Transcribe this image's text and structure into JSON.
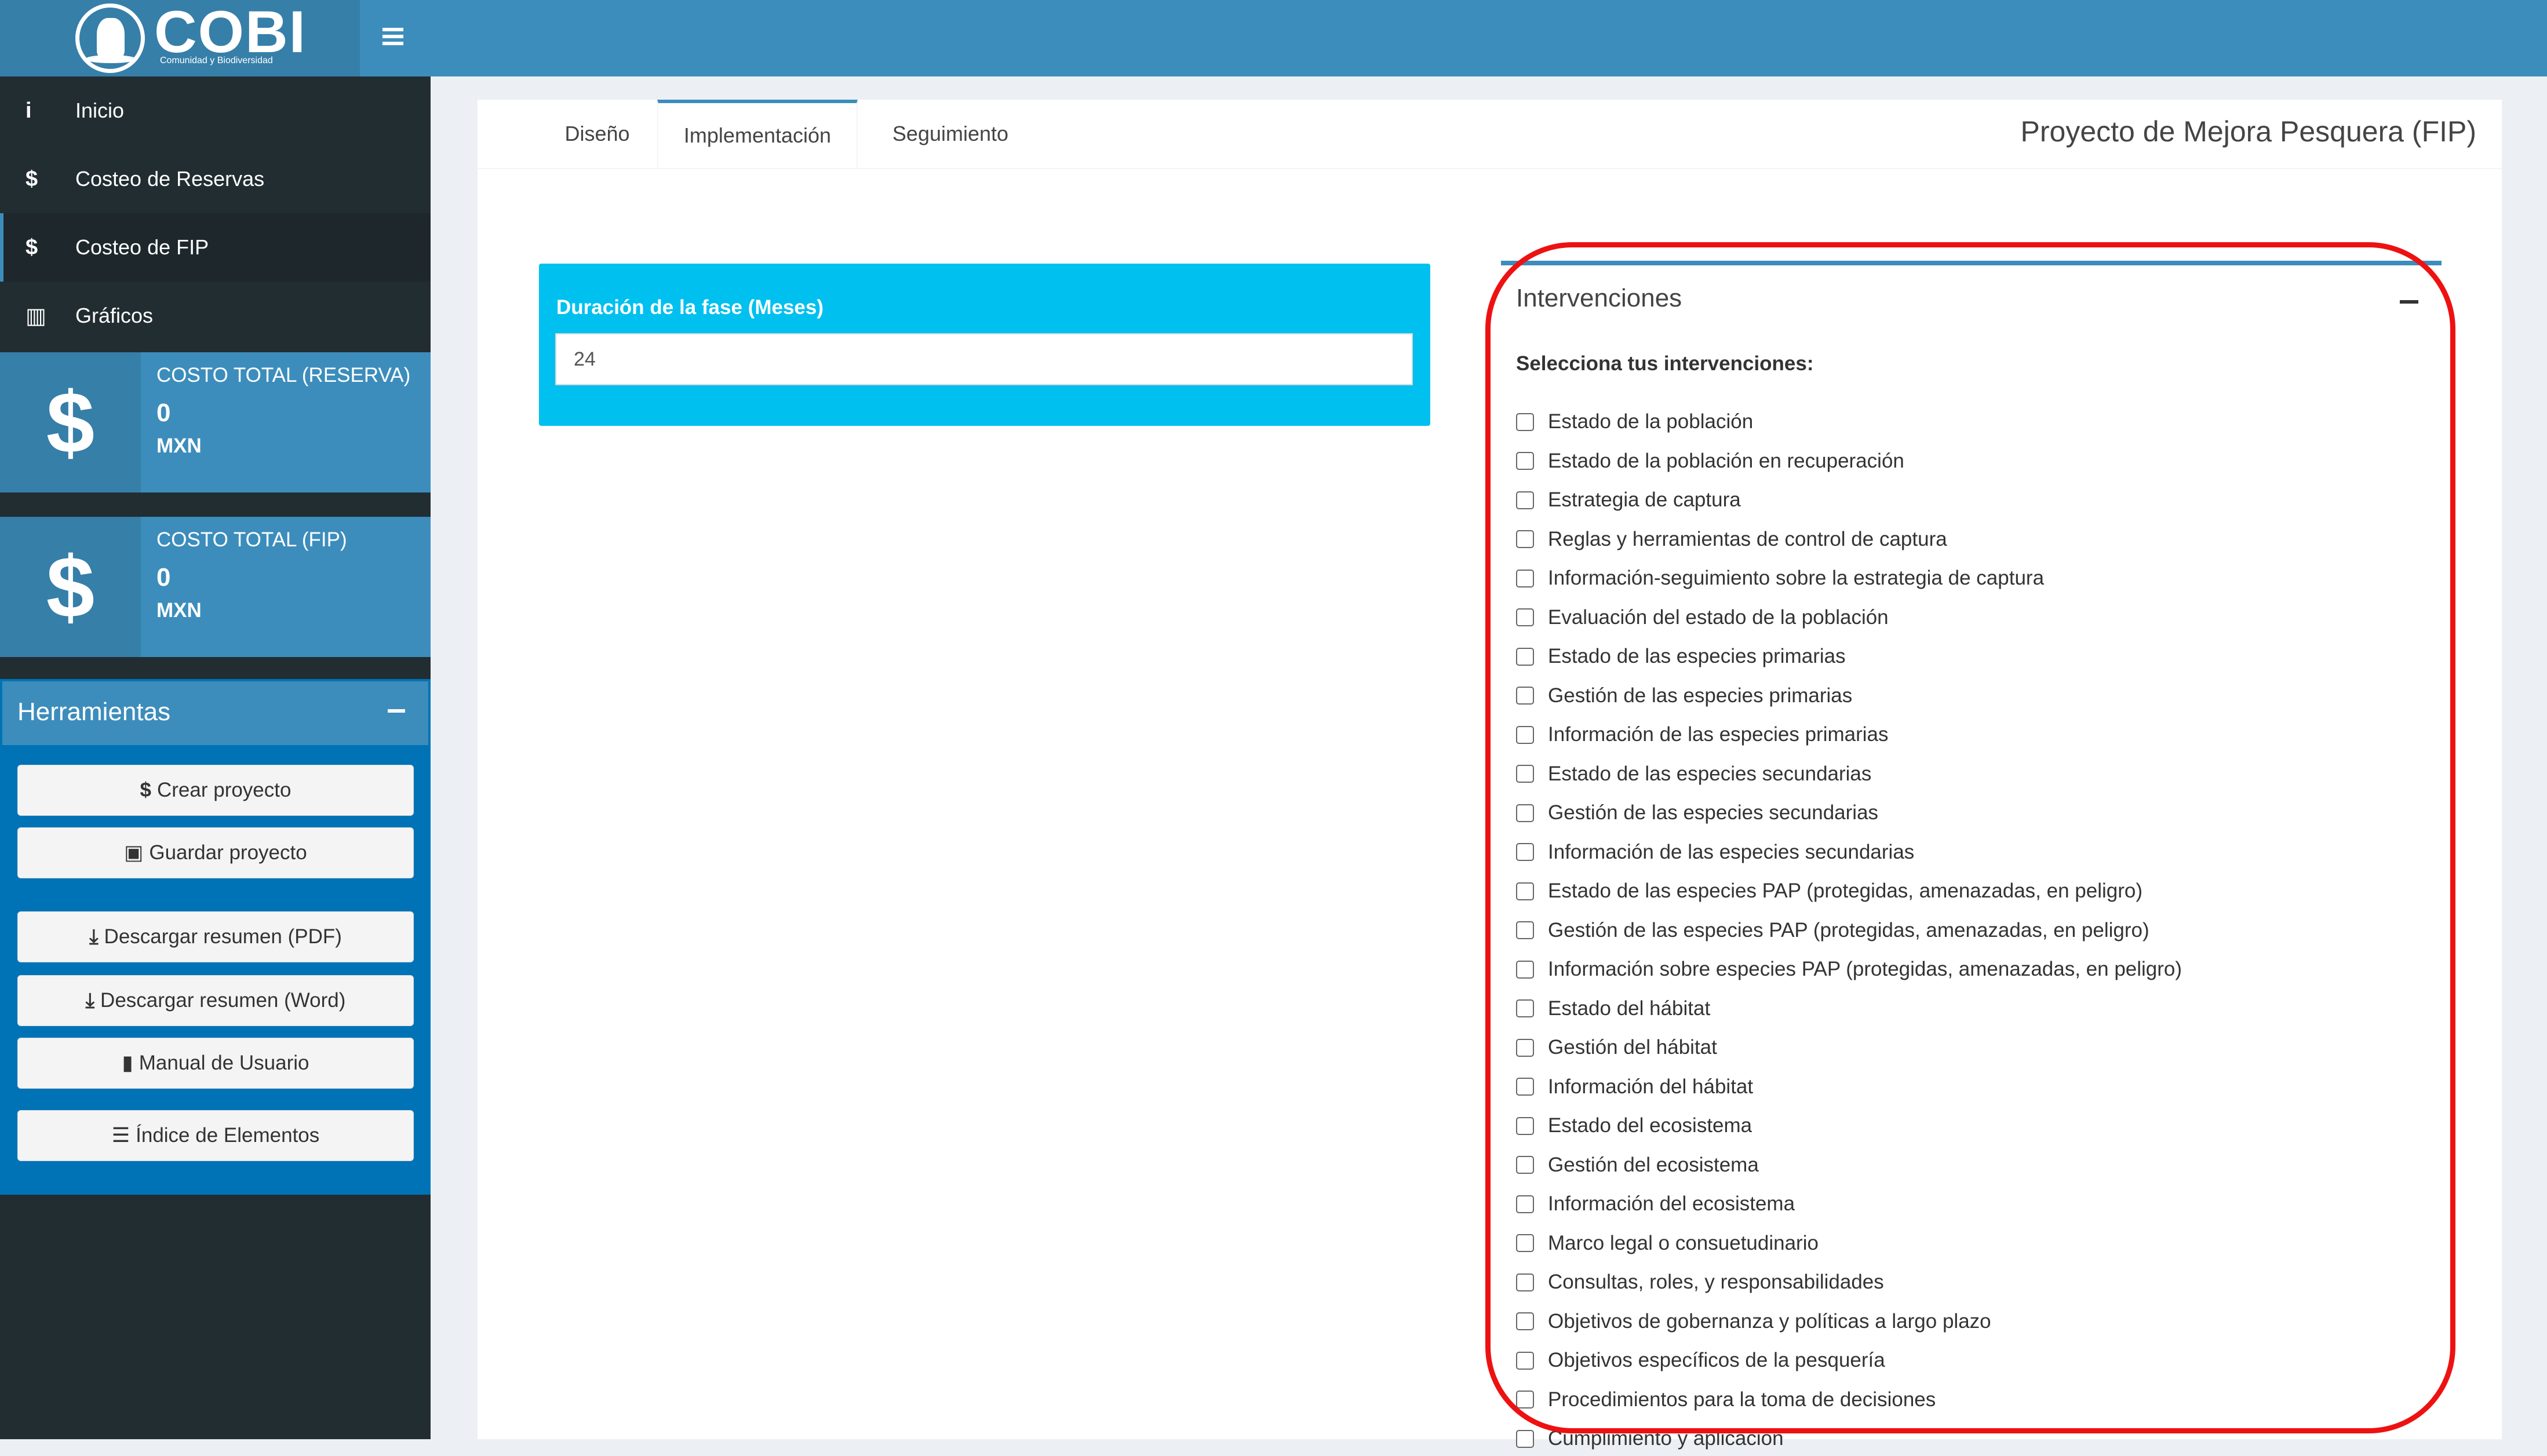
{
  "header": {
    "logo_text": "COBI",
    "logo_subtitle": "Comunidad y Biodiversidad"
  },
  "sidebar": {
    "items": [
      {
        "icon": "info-icon",
        "glyph": "i",
        "label": "Inicio"
      },
      {
        "icon": "dollar-icon",
        "glyph": "$",
        "label": "Costeo de Reservas"
      },
      {
        "icon": "dollar-icon",
        "glyph": "$",
        "label": "Costeo de FIP",
        "active": true
      },
      {
        "icon": "bar-chart-icon",
        "glyph": "▥",
        "label": "Gráficos"
      }
    ],
    "value_boxes": [
      {
        "title": "COSTO TOTAL (RESERVA)",
        "value": "0",
        "unit": "MXN",
        "icon": "dollar-icon"
      },
      {
        "title": "COSTO TOTAL (FIP)",
        "value": "0",
        "unit": "MXN",
        "icon": "dollar-icon"
      }
    ],
    "tools": {
      "title": "Herramientas",
      "buttons": [
        {
          "icon": "dollar-icon",
          "glyph": "$",
          "label": "Crear proyecto"
        },
        {
          "icon": "save-icon",
          "glyph": "▣",
          "label": "Guardar proyecto"
        },
        {
          "icon": "download-icon",
          "glyph": "⤓",
          "label": "Descargar resumen (PDF)"
        },
        {
          "icon": "download-icon",
          "glyph": "⤓",
          "label": "Descargar resumen (Word)"
        },
        {
          "icon": "book-icon",
          "glyph": "▮",
          "label": "Manual de Usuario"
        },
        {
          "icon": "list-icon",
          "glyph": "☰",
          "label": "Índice de Elementos"
        }
      ]
    }
  },
  "main": {
    "tabs": [
      {
        "label": "Diseño"
      },
      {
        "label": "Implementación",
        "active": true
      },
      {
        "label": "Seguimiento"
      }
    ],
    "page_title": "Proyecto de Mejora Pesquera (FIP)",
    "duration": {
      "label": "Duración de la fase (Meses)",
      "value": "24"
    },
    "intervenciones": {
      "title": "Intervenciones",
      "subtitle": "Selecciona tus intervenciones:",
      "options": [
        "Estado de la población",
        "Estado de la población en recuperación",
        "Estrategia de captura",
        "Reglas y herramientas de control de captura",
        "Información-seguimiento sobre la estrategia de captura",
        "Evaluación del estado de la población",
        "Estado de las especies primarias",
        "Gestión de las especies primarias",
        "Información de las especies primarias",
        "Estado de las especies secundarias",
        "Gestión de las especies secundarias",
        "Información de las especies secundarias",
        "Estado de las especies PAP (protegidas, amenazadas, en peligro)",
        "Gestión de las especies PAP (protegidas, amenazadas, en peligro)",
        "Información sobre especies PAP (protegidas, amenazadas, en peligro)",
        "Estado del hábitat",
        "Gestión del hábitat",
        "Información del hábitat",
        "Estado del ecosistema",
        "Gestión del ecosistema",
        "Información del ecosistema",
        "Marco legal o consuetudinario",
        "Consultas, roles, y responsabilidades",
        "Objetivos de gobernanza y políticas a largo plazo",
        "Objetivos específicos de la pesquería",
        "Procedimientos para la toma de decisiones",
        "Cumplimiento y aplicación"
      ]
    }
  },
  "colors": {
    "header": "#3c8dbc",
    "sidebar": "#222d32",
    "info_box": "#00c0ef",
    "highlight": "#ee1111"
  }
}
